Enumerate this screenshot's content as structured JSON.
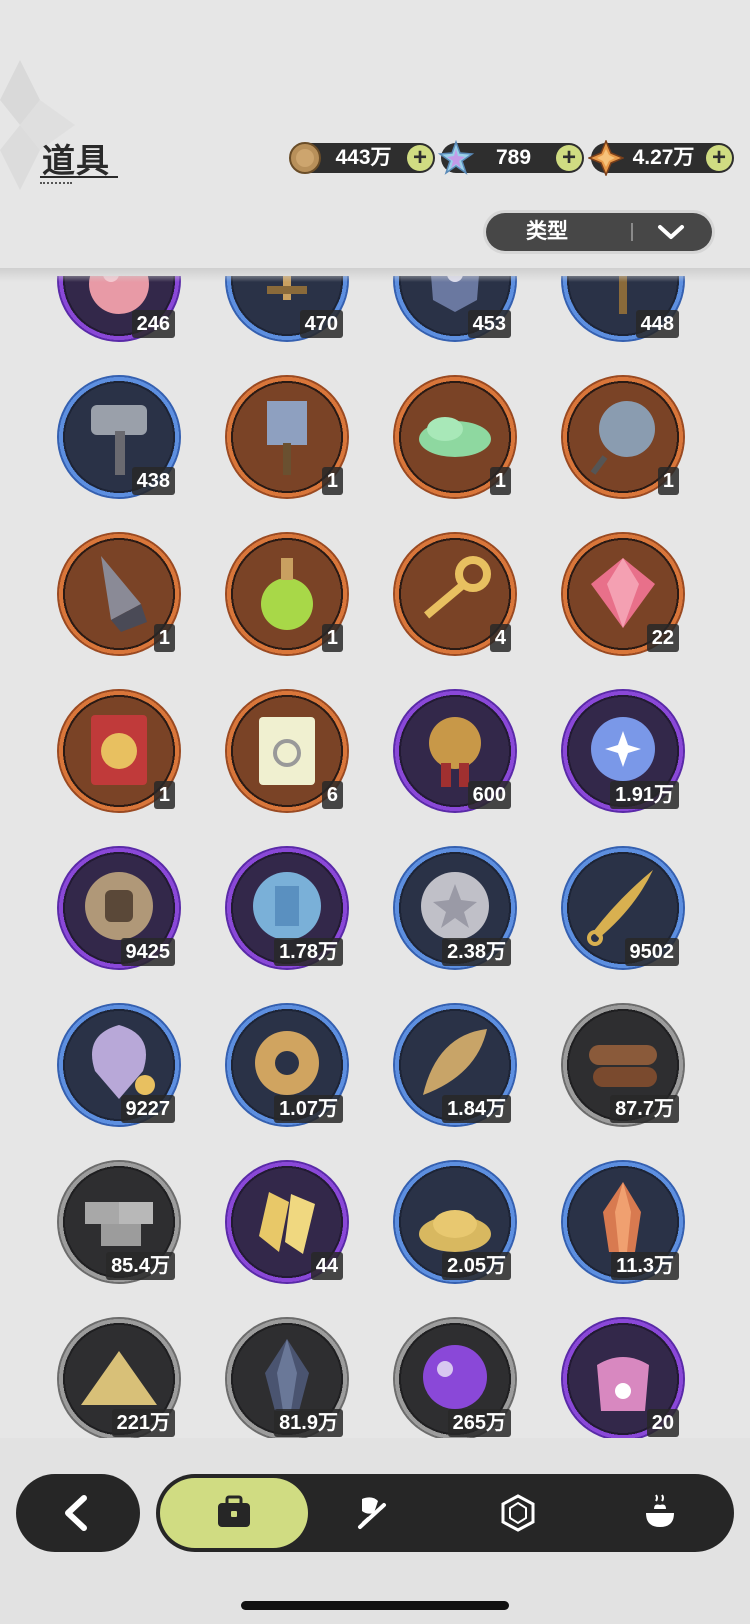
{
  "page": {
    "title": "道具"
  },
  "currencies": [
    {
      "icon": "gold-coin-icon",
      "value": "443万"
    },
    {
      "icon": "crystal-star-icon",
      "value": "789"
    },
    {
      "icon": "orange-star-gem-icon",
      "value": "4.27万"
    }
  ],
  "filter": {
    "label": "类型"
  },
  "colors": {
    "accent": "#d0dc82",
    "orange_rarity": "#d9763a",
    "blue_rarity": "#5d8fe0",
    "purple_rarity": "#8a48d8",
    "gray_rarity": "#9c9c9c"
  },
  "items": [
    {
      "name": "pink-orb-item",
      "rarity": "purple",
      "count": "246"
    },
    {
      "name": "sword-hilt-item",
      "rarity": "blue",
      "count": "470"
    },
    {
      "name": "armor-piece-item",
      "rarity": "blue",
      "count": "453"
    },
    {
      "name": "pickaxe-item",
      "rarity": "blue",
      "count": "448"
    },
    {
      "name": "war-hammer-item",
      "rarity": "blue",
      "count": "438"
    },
    {
      "name": "spiked-mallet-item",
      "rarity": "orange",
      "count": "1"
    },
    {
      "name": "green-cloud-item",
      "rarity": "orange",
      "count": "1"
    },
    {
      "name": "spiked-flail-item",
      "rarity": "orange",
      "count": "1"
    },
    {
      "name": "drill-item",
      "rarity": "orange",
      "count": "1"
    },
    {
      "name": "green-potion-item",
      "rarity": "orange",
      "count": "1"
    },
    {
      "name": "golden-key-item",
      "rarity": "orange",
      "count": "4"
    },
    {
      "name": "pink-gem-item",
      "rarity": "orange",
      "count": "22"
    },
    {
      "name": "wheel-ticket-item",
      "rarity": "orange",
      "count": "1"
    },
    {
      "name": "rainbow-ticket-item",
      "rarity": "orange",
      "count": "6"
    },
    {
      "name": "gold-medal-item",
      "rarity": "purple",
      "count": "600"
    },
    {
      "name": "star-moon-orb-item",
      "rarity": "purple",
      "count": "1.91万"
    },
    {
      "name": "fist-coin-item",
      "rarity": "purple",
      "count": "9425"
    },
    {
      "name": "blue-shield-coin-item",
      "rarity": "purple",
      "count": "1.78万"
    },
    {
      "name": "silver-star-coin-item",
      "rarity": "blue",
      "count": "2.38万"
    },
    {
      "name": "golden-blade-item",
      "rarity": "blue",
      "count": "9502"
    },
    {
      "name": "scale-pendant-item",
      "rarity": "blue",
      "count": "9227"
    },
    {
      "name": "gear-item",
      "rarity": "blue",
      "count": "1.07万"
    },
    {
      "name": "golden-leaf-item",
      "rarity": "blue",
      "count": "1.84万"
    },
    {
      "name": "wood-logs-item",
      "rarity": "gray",
      "count": "87.7万"
    },
    {
      "name": "stone-bricks-item",
      "rarity": "gray",
      "count": "85.4万"
    },
    {
      "name": "gold-shards-item",
      "rarity": "purple",
      "count": "44"
    },
    {
      "name": "gold-dust-pile-item",
      "rarity": "blue",
      "count": "2.05万"
    },
    {
      "name": "red-crystal-item",
      "rarity": "blue",
      "count": "11.3万"
    },
    {
      "name": "sand-pile-item",
      "rarity": "gray",
      "count": "221万"
    },
    {
      "name": "dark-crystal-item",
      "rarity": "gray",
      "count": "81.9万"
    },
    {
      "name": "purple-sphere-item",
      "rarity": "gray",
      "count": "265万"
    },
    {
      "name": "paw-pouch-item",
      "rarity": "purple",
      "count": "20"
    }
  ],
  "nav": {
    "back_icon": "chevron-left-icon",
    "tabs": [
      {
        "icon": "briefcase-icon",
        "active": true
      },
      {
        "icon": "hat-sword-icon",
        "active": false
      },
      {
        "icon": "hexagon-gem-icon",
        "active": false
      },
      {
        "icon": "cooking-pot-icon",
        "active": false
      }
    ]
  }
}
